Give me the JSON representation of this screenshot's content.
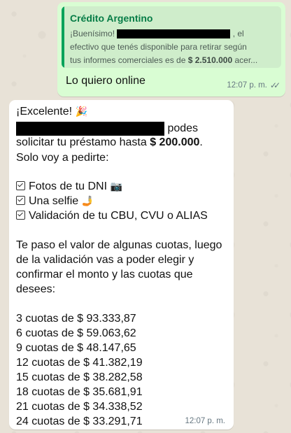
{
  "outgoing": {
    "quote": {
      "title": "Crédito Argentino",
      "line1_pre": "¡Buenísimo!",
      "line1_post": ", el",
      "line2": "efectivo que tenés disponible para retirar según",
      "line3_pre": "tus informes comerciales es de ",
      "line3_amount": "$ 2.510.000",
      "line3_post": " acer..."
    },
    "text": "Lo quiero online",
    "time": "12:07 p. m.",
    "ticks": "✓✓"
  },
  "incoming": {
    "greeting": "¡Excelente!",
    "greeting_emoji": "🎉",
    "line_after_redact": "podes",
    "line2_pre": "solicitar tu préstamo hasta ",
    "line2_amount": "$ 200.000",
    "line2_post": ".",
    "line3": "Solo voy a pedirte:",
    "requirements": [
      {
        "text": "Fotos de tu DNI",
        "emoji": "📷"
      },
      {
        "text": "Una selfie",
        "emoji": "🤳"
      },
      {
        "text": "Validación de tu CBU, CVU o ALIAS",
        "emoji": ""
      }
    ],
    "paragraph": [
      "Te paso el valor de algunas cuotas, luego",
      "de la validación vas a poder elegir y",
      "confirmar el monto y las cuotas que",
      "desees:"
    ],
    "installments": [
      "3 cuotas de $ 93.333,87",
      "6 cuotas de $ 59.063,62",
      "9 cuotas de $ 48.147,65",
      "12 cuotas de $ 41.382,19",
      "15 cuotas de $ 38.282,58",
      "18 cuotas de $ 35.681,91",
      "21 cuotas de $ 34.338,52",
      "24 cuotas de $ 33.291,71"
    ],
    "time": "12:07 p. m."
  }
}
